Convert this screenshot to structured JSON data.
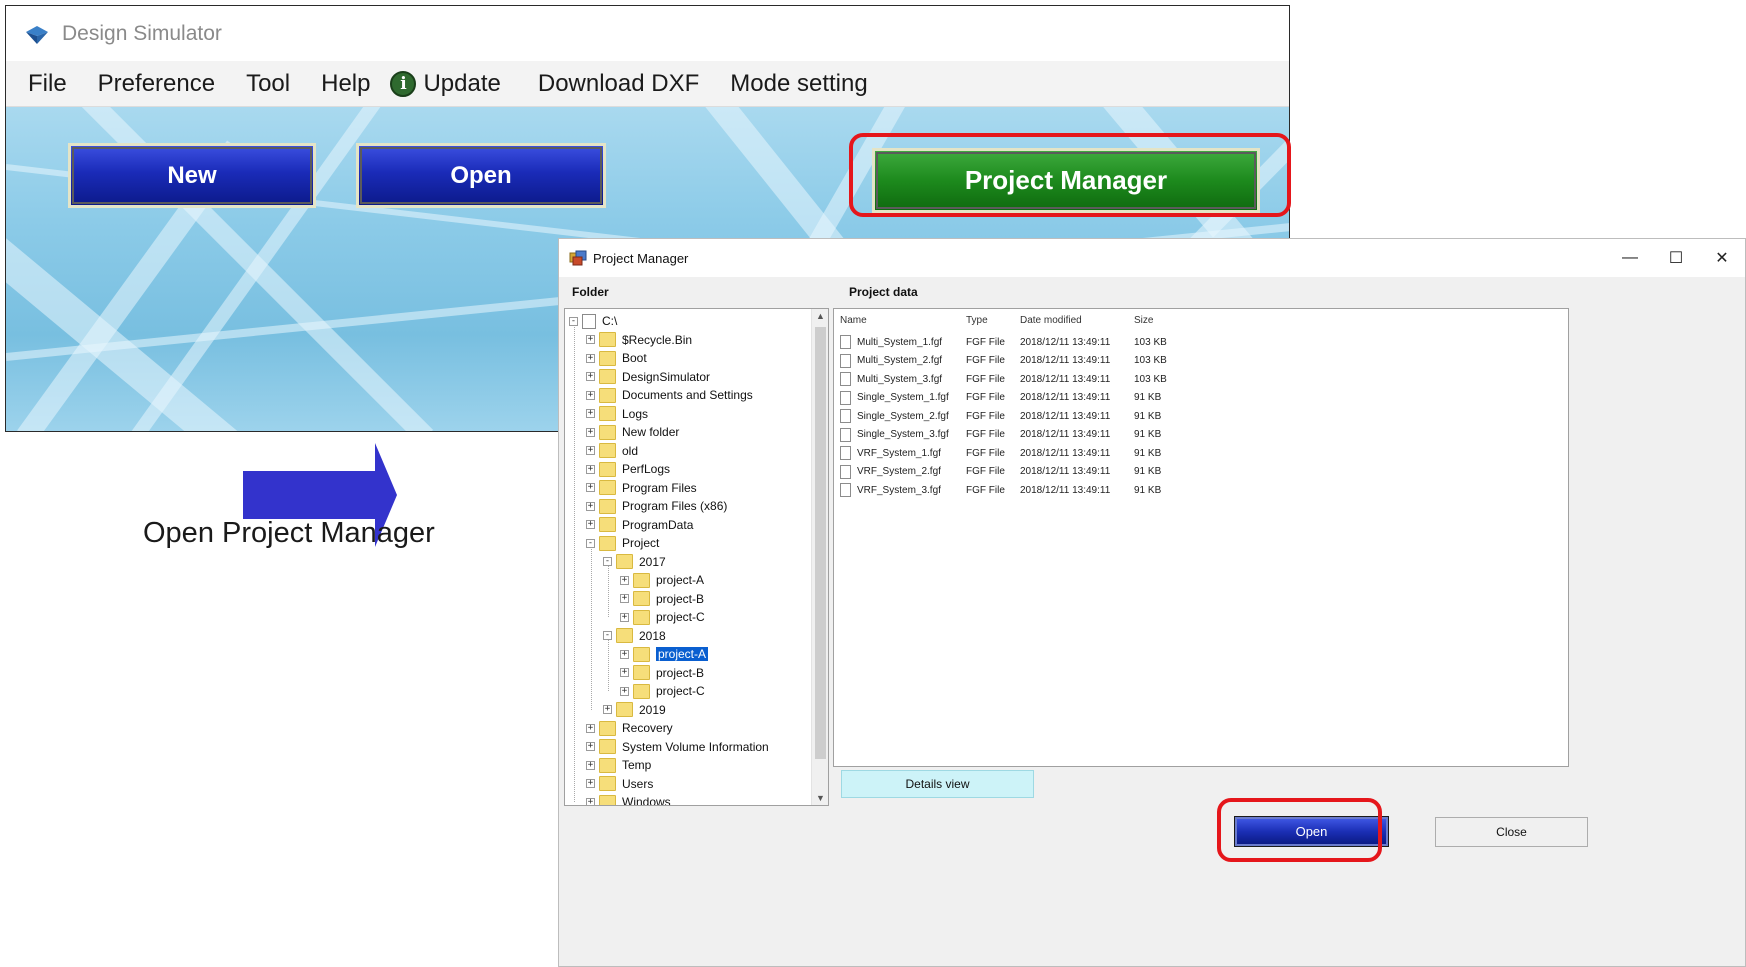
{
  "main_window": {
    "title": "Design Simulator",
    "menu": [
      "File",
      "Preference",
      "Tool",
      "Help",
      "Update",
      "Download DXF",
      "Mode setting"
    ],
    "buttons": {
      "new": "New",
      "open": "Open",
      "project_manager": "Project Manager"
    }
  },
  "annotation": {
    "caption": "Open Project Manager"
  },
  "project_manager": {
    "title": "Project Manager",
    "folder_label": "Folder",
    "project_data_label": "Project data",
    "tree": [
      {
        "label": "C:\\",
        "level": 0,
        "toggle": "-",
        "icon": "drive",
        "selected": false
      },
      {
        "label": "$Recycle.Bin",
        "level": 1,
        "toggle": "+",
        "icon": "folder",
        "selected": false
      },
      {
        "label": "Boot",
        "level": 1,
        "toggle": "+",
        "icon": "folder",
        "selected": false
      },
      {
        "label": "DesignSimulator",
        "level": 1,
        "toggle": "+",
        "icon": "folder",
        "selected": false
      },
      {
        "label": "Documents and Settings",
        "level": 1,
        "toggle": "+",
        "icon": "folder",
        "selected": false
      },
      {
        "label": "Logs",
        "level": 1,
        "toggle": "+",
        "icon": "folder",
        "selected": false
      },
      {
        "label": "New folder",
        "level": 1,
        "toggle": "+",
        "icon": "folder",
        "selected": false
      },
      {
        "label": "old",
        "level": 1,
        "toggle": "+",
        "icon": "folder",
        "selected": false
      },
      {
        "label": "PerfLogs",
        "level": 1,
        "toggle": "+",
        "icon": "folder",
        "selected": false
      },
      {
        "label": "Program Files",
        "level": 1,
        "toggle": "+",
        "icon": "folder",
        "selected": false
      },
      {
        "label": "Program Files (x86)",
        "level": 1,
        "toggle": "+",
        "icon": "folder",
        "selected": false
      },
      {
        "label": "ProgramData",
        "level": 1,
        "toggle": "+",
        "icon": "folder",
        "selected": false
      },
      {
        "label": "Project",
        "level": 1,
        "toggle": "-",
        "icon": "folder",
        "selected": false
      },
      {
        "label": "2017",
        "level": 2,
        "toggle": "-",
        "icon": "folder",
        "selected": false
      },
      {
        "label": "project-A",
        "level": 3,
        "toggle": "+",
        "icon": "folder",
        "selected": false
      },
      {
        "label": "project-B",
        "level": 3,
        "toggle": "+",
        "icon": "folder",
        "selected": false
      },
      {
        "label": "project-C",
        "level": 3,
        "toggle": "+",
        "icon": "folder",
        "selected": false
      },
      {
        "label": "2018",
        "level": 2,
        "toggle": "-",
        "icon": "folder",
        "selected": false
      },
      {
        "label": "project-A",
        "level": 3,
        "toggle": "+",
        "icon": "folder",
        "selected": true
      },
      {
        "label": "project-B",
        "level": 3,
        "toggle": "+",
        "icon": "folder",
        "selected": false
      },
      {
        "label": "project-C",
        "level": 3,
        "toggle": "+",
        "icon": "folder",
        "selected": false
      },
      {
        "label": "2019",
        "level": 2,
        "toggle": "+",
        "icon": "folder",
        "selected": false
      },
      {
        "label": "Recovery",
        "level": 1,
        "toggle": "+",
        "icon": "folder",
        "selected": false
      },
      {
        "label": "System Volume Information",
        "level": 1,
        "toggle": "+",
        "icon": "folder",
        "selected": false
      },
      {
        "label": "Temp",
        "level": 1,
        "toggle": "+",
        "icon": "folder",
        "selected": false
      },
      {
        "label": "Users",
        "level": 1,
        "toggle": "+",
        "icon": "folder",
        "selected": false
      },
      {
        "label": "Windows",
        "level": 1,
        "toggle": "+",
        "icon": "folder",
        "selected": false
      }
    ],
    "columns": [
      "Name",
      "Type",
      "Date modified",
      "Size"
    ],
    "files": [
      {
        "name": "Multi_System_1.fgf",
        "type": "FGF File",
        "date": "2018/12/11 13:49:11",
        "size": "103 KB"
      },
      {
        "name": "Multi_System_2.fgf",
        "type": "FGF File",
        "date": "2018/12/11 13:49:11",
        "size": "103 KB"
      },
      {
        "name": "Multi_System_3.fgf",
        "type": "FGF File",
        "date": "2018/12/11 13:49:11",
        "size": "103 KB"
      },
      {
        "name": "Single_System_1.fgf",
        "type": "FGF File",
        "date": "2018/12/11 13:49:11",
        "size": "91 KB"
      },
      {
        "name": "Single_System_2.fgf",
        "type": "FGF File",
        "date": "2018/12/11 13:49:11",
        "size": "91 KB"
      },
      {
        "name": "Single_System_3.fgf",
        "type": "FGF File",
        "date": "2018/12/11 13:49:11",
        "size": "91 KB"
      },
      {
        "name": "VRF_System_1.fgf",
        "type": "FGF File",
        "date": "2018/12/11 13:49:11",
        "size": "91 KB"
      },
      {
        "name": "VRF_System_2.fgf",
        "type": "FGF File",
        "date": "2018/12/11 13:49:11",
        "size": "91 KB"
      },
      {
        "name": "VRF_System_3.fgf",
        "type": "FGF File",
        "date": "2018/12/11 13:49:11",
        "size": "91 KB"
      }
    ],
    "details_view_label": "Details view",
    "open_label": "Open",
    "close_label": "Close"
  },
  "colors": {
    "highlight": "#e5161b",
    "arrow": "#3333cc",
    "selection": "#0a5fd0"
  }
}
